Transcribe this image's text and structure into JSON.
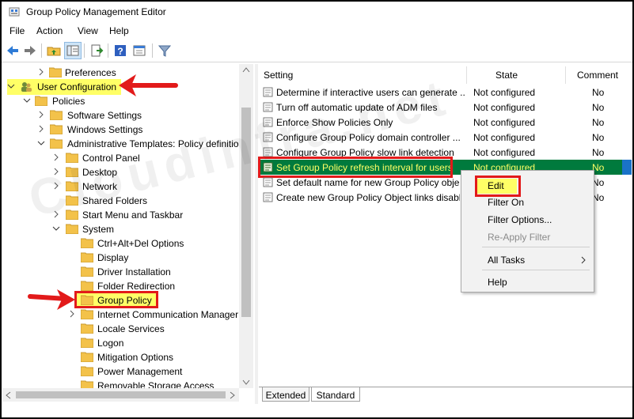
{
  "window": {
    "title": "Group Policy Management Editor"
  },
  "menu": {
    "items": [
      "File",
      "Action",
      "View",
      "Help"
    ]
  },
  "toolbar": {
    "buttons": [
      "back-icon",
      "forward-icon",
      "up-folder-icon",
      "show-hide-tree-icon",
      "export-list-icon",
      "help-icon",
      "properties-icon",
      "filter-icon"
    ]
  },
  "tree": {
    "preferences": "Preferences",
    "user_configuration": "User Configuration",
    "policies": "Policies",
    "software_settings": "Software Settings",
    "windows_settings": "Windows Settings",
    "admin_templates": "Administrative Templates: Policy definitio",
    "control_panel": "Control Panel",
    "desktop": "Desktop",
    "network": "Network",
    "shared_folders": "Shared Folders",
    "start_menu": "Start Menu and Taskbar",
    "system": "System",
    "ctrl_alt_del": "Ctrl+Alt+Del Options",
    "display": "Display",
    "driver_installation": "Driver Installation",
    "folder_redirection": "Folder Redirection",
    "group_policy": "Group Policy",
    "internet_communication": "Internet Communication Manager",
    "locale_services": "Locale Services",
    "logon": "Logon",
    "mitigation_options": "Mitigation Options",
    "power_management": "Power Management",
    "removable_storage": "Removable Storage Access"
  },
  "list": {
    "headers": {
      "setting": "Setting",
      "state": "State",
      "comment": "Comment"
    },
    "rows": [
      {
        "setting": "Determine if interactive users can generate ...",
        "state": "Not configured",
        "comment": "No"
      },
      {
        "setting": "Turn off automatic update of ADM files",
        "state": "Not configured",
        "comment": "No"
      },
      {
        "setting": "Enforce Show Policies Only",
        "state": "Not configured",
        "comment": "No"
      },
      {
        "setting": "Configure Group Policy domain controller ...",
        "state": "Not configured",
        "comment": "No"
      },
      {
        "setting": "Configure Group Policy slow link detection",
        "state": "Not configured",
        "comment": "No"
      },
      {
        "setting": "Set Group Policy refresh interval for users",
        "state": "Not configured",
        "comment": "No"
      },
      {
        "setting": "Set default name for new Group Policy obje...",
        "state": "",
        "comment": "No"
      },
      {
        "setting": "Create new Group Policy Object links disabl...",
        "state": "",
        "comment": "No"
      }
    ]
  },
  "context_menu": {
    "edit": "Edit",
    "filter_on": "Filter On",
    "filter_options": "Filter Options...",
    "reapply_filter": "Re-Apply Filter",
    "all_tasks": "All Tasks",
    "help": "Help"
  },
  "tabs": {
    "extended": "Extended",
    "standard": "Standard"
  },
  "watermark": "Cloudinfra.net",
  "colors": {
    "selection": "#007a3d",
    "selection_text": "#ffff66",
    "highlight": "#ffff66",
    "annotation_red": "#e21a1a",
    "folder": "#f3c24a"
  }
}
